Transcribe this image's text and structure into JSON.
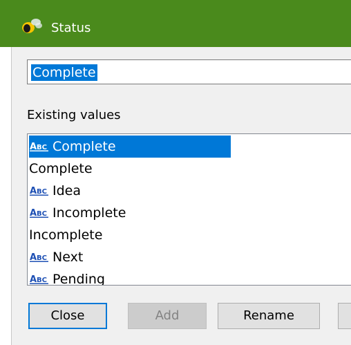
{
  "window": {
    "title": "Status",
    "title_icon": "bee-icon"
  },
  "input": {
    "value": "Complete"
  },
  "existing_values": {
    "label": "Existing values",
    "items": [
      {
        "label": "Complete",
        "icon": "abc-text-icon",
        "selected": true
      },
      {
        "label": "Complete",
        "icon": null,
        "selected": false
      },
      {
        "label": "Idea",
        "icon": "abc-text-icon",
        "selected": false
      },
      {
        "label": "Incomplete",
        "icon": "abc-text-icon",
        "selected": false
      },
      {
        "label": "Incomplete",
        "icon": null,
        "selected": false
      },
      {
        "label": "Next",
        "icon": "abc-text-icon",
        "selected": false
      },
      {
        "label": "Pending",
        "icon": "abc-text-icon",
        "selected": false
      }
    ]
  },
  "buttons": {
    "close": "Close",
    "add": "Add",
    "rename": "Rename"
  },
  "colors": {
    "titlebar": "#4a8a1c",
    "selection": "#0078d7"
  }
}
